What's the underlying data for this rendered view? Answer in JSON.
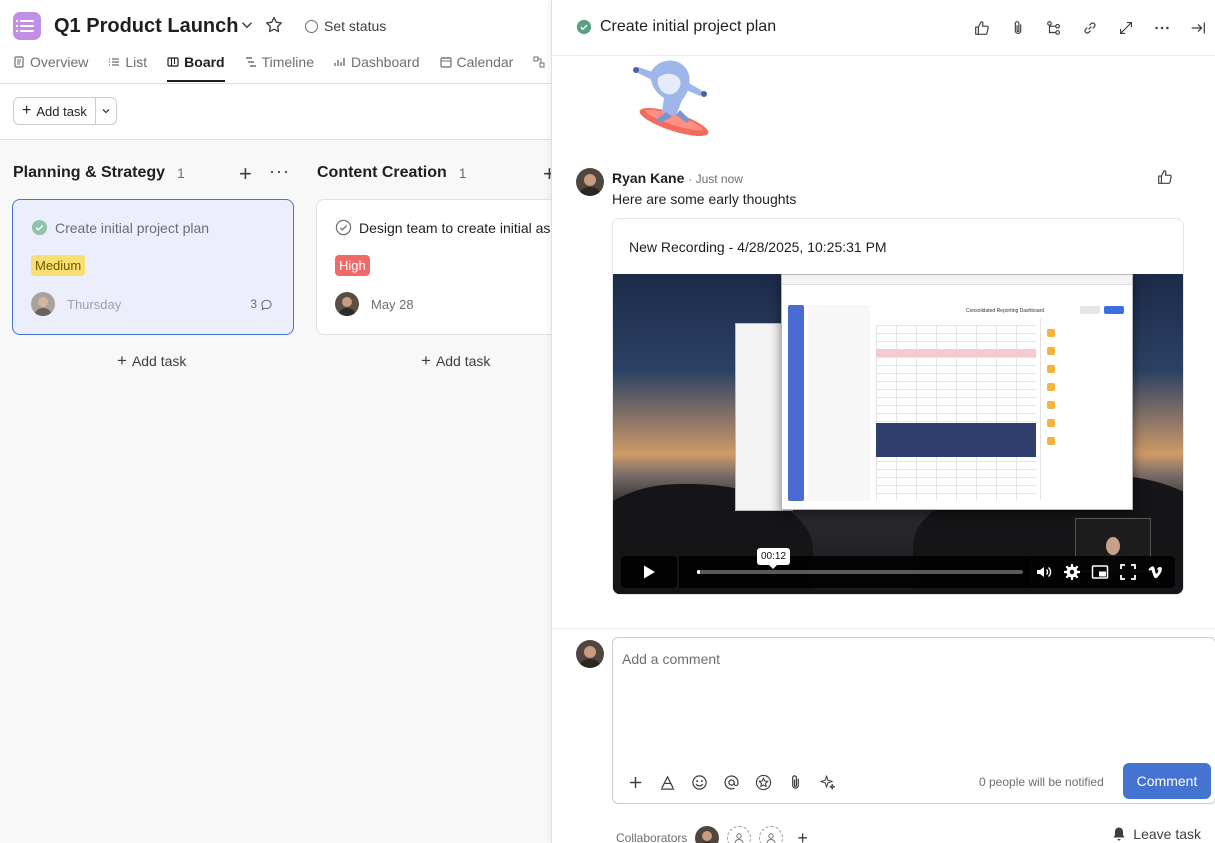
{
  "project": {
    "title": "Q1 Product Launch",
    "set_status": "Set status"
  },
  "tabs": [
    {
      "label": "Overview"
    },
    {
      "label": "List"
    },
    {
      "label": "Board"
    },
    {
      "label": "Timeline"
    },
    {
      "label": "Dashboard"
    },
    {
      "label": "Calendar"
    }
  ],
  "active_tab": "Board",
  "toolbar": {
    "add_task": "Add task"
  },
  "columns": [
    {
      "title": "Planning & Strategy",
      "count": "1",
      "add_task": "Add task",
      "card": {
        "title": "Create initial project plan",
        "priority": "Medium",
        "date": "Thursday",
        "comments": "3"
      }
    },
    {
      "title": "Content Creation",
      "count": "1",
      "add_task": "Add task",
      "card": {
        "title": "Design team to create initial assets",
        "priority": "High",
        "date": "May 28"
      }
    }
  ],
  "detail": {
    "title": "Create initial project plan",
    "comment": {
      "author": "Ryan Kane",
      "time": "· Just now",
      "body": "Here are some early thoughts"
    },
    "recording": {
      "title": "New Recording - 4/28/2025, 10:25:31 PM",
      "time_tooltip": "00:12",
      "progress": 0.01,
      "screen_title": "Consolidated Reporting Dashboard"
    },
    "composer": {
      "placeholder": "Add a comment",
      "notified": "0 people will be notified",
      "submit": "Comment"
    },
    "collaborators_label": "Collaborators",
    "leave_task": "Leave task"
  },
  "colors": {
    "accent": "#4573d2",
    "project_icon": "#c18fe6",
    "complete_green": "#58a182",
    "medium": "#f8df72",
    "high": "#f06a6a"
  },
  "icons": {
    "header": [
      "like-icon",
      "attachment-icon",
      "subtask-icon",
      "link-icon",
      "expand-icon",
      "more-icon",
      "close-pane-icon"
    ],
    "composer": [
      "plus-icon",
      "format-icon",
      "emoji-icon",
      "mention-icon",
      "star-icon",
      "attach-icon",
      "ai-sparkle-icon"
    ]
  }
}
